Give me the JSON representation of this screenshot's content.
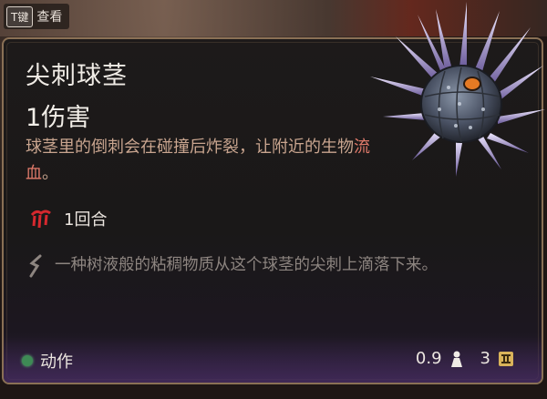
{
  "hint": {
    "key": "T键",
    "label": "查看"
  },
  "item": {
    "name": "尖刺球茎",
    "damage": "1伤害",
    "description_part1": "球茎里的倒刺会在碰撞后炸裂，让附近的生物",
    "description_highlight": "流血",
    "description_part2": "。",
    "duration": "1回合",
    "flavor": "一种树液般的粘稠物质从这个球茎的尖刺上滴落下来。"
  },
  "footer": {
    "action_label": "动作",
    "weight": "0.9",
    "price": "3"
  },
  "icons": {
    "bleed": "bleed-icon",
    "flavor": "quote-icon",
    "weight": "weight-icon",
    "price": "gold-icon",
    "action": "action-dot-icon"
  },
  "colors": {
    "title": "#f0ece6",
    "description": "#c9a58f",
    "highlight": "#e07a6a",
    "flavor": "#8d8580",
    "border": "#8a7055",
    "action_dot": "#3e8a55"
  }
}
